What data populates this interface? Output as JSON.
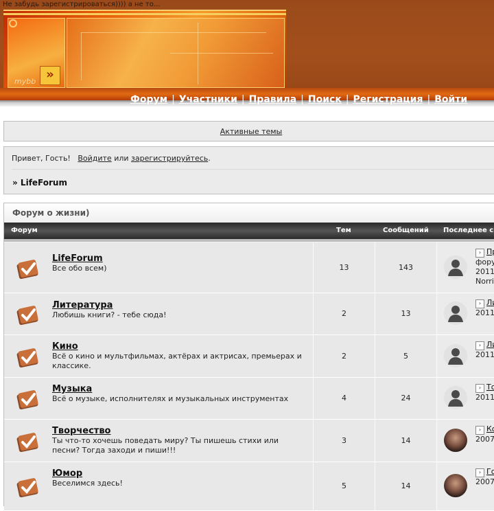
{
  "announcement": "Не забудь зарегистрироваться)))) а не то...",
  "logo": {
    "text": "mybb",
    "arrow": "»"
  },
  "nav": {
    "items": [
      "Форум",
      "Участники",
      "Правила",
      "Поиск",
      "Регистрация",
      "Войти"
    ],
    "separator": "|"
  },
  "active_topics": "Активные темы",
  "welcome": {
    "greeting": "Привет, Гость!",
    "login_link": "Войдите",
    "or_text": "или",
    "register_link": "зарегистрируйтесь",
    "tail": "."
  },
  "breadcrumb": "» LifeForum",
  "category": {
    "title": "Форум о жизни)",
    "headers": {
      "forum": "Форум",
      "topics": "Тем",
      "posts": "Сообщений",
      "last": "Последнее с"
    }
  },
  "forums": [
    {
      "name": "LifeForum",
      "desc": "Все обо всем)",
      "topics": "13",
      "posts": "143",
      "last": {
        "title": "Пр",
        "lines": [
          "фору",
          "2011",
          "Norri"
        ],
        "avatar": "silhouette"
      }
    },
    {
      "name": "Литература",
      "desc": "Любишь книги? - тебе сюда!",
      "topics": "2",
      "posts": "13",
      "last": {
        "title": "Ли",
        "lines": [
          "2011"
        ],
        "avatar": "silhouette"
      }
    },
    {
      "name": "Кино",
      "desc": "Всё о кино и мультфильмах, актёрах и актрисах, премьерах и классике.",
      "topics": "2",
      "posts": "5",
      "last": {
        "title": "Ли",
        "lines": [
          "2011"
        ],
        "avatar": "silhouette"
      }
    },
    {
      "name": "Музыка",
      "desc": "Всё о музыке, исполнителях и музыкальных инструментах",
      "topics": "4",
      "posts": "24",
      "last": {
        "title": "То",
        "lines": [
          "2011"
        ],
        "avatar": "silhouette"
      }
    },
    {
      "name": "Творчество",
      "desc": "Ты что-то хочешь поведать миру? Ты пишешь стихи или песни? Тогда заходи и пиши!!!",
      "topics": "3",
      "posts": "14",
      "last": {
        "title": "Ко",
        "lines": [
          "2007"
        ],
        "avatar": "photo"
      }
    },
    {
      "name": "Юмор",
      "desc": "Веселимся здесь!",
      "topics": "5",
      "posts": "14",
      "last": {
        "title": "Го",
        "lines": [
          "2007"
        ],
        "avatar": "photo"
      }
    }
  ]
}
